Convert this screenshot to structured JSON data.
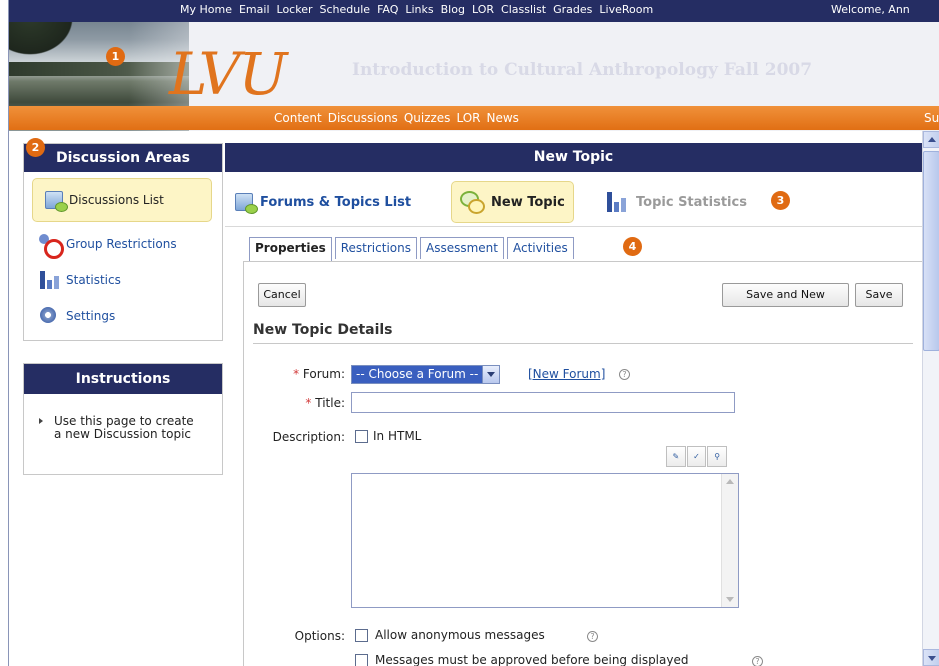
{
  "topnav": {
    "items": [
      "My Home",
      "Email",
      "Locker",
      "Schedule",
      "FAQ",
      "Links",
      "Blog",
      "LOR",
      "Classlist",
      "Grades",
      "LiveRoom"
    ],
    "welcome": "Welcome, Ann"
  },
  "banner": {
    "logo": "LVU",
    "course_title": "Introduction to Cultural Anthropology Fall 2007"
  },
  "subnav": {
    "items": [
      "Content",
      "Discussions",
      "Quizzes",
      "LOR",
      "News"
    ],
    "overflow": "Su"
  },
  "callouts": [
    "1",
    "2",
    "3",
    "4"
  ],
  "sidebar": {
    "title": "Discussion Areas",
    "items": [
      {
        "label": "Discussions List",
        "icon": "discussions-list-icon"
      },
      {
        "label": "Group Restrictions",
        "icon": "group-restrictions-icon"
      },
      {
        "label": "Statistics",
        "icon": "statistics-icon"
      },
      {
        "label": "Settings",
        "icon": "settings-icon"
      }
    ]
  },
  "instructions": {
    "title": "Instructions",
    "text": "Use this page to create a new Discussion topic"
  },
  "main": {
    "title": "New Topic",
    "actions": [
      {
        "label": "Forums & Topics List",
        "icon": "forums-list-icon"
      },
      {
        "label": "New Topic",
        "icon": "new-topic-icon"
      },
      {
        "label": "Topic Statistics",
        "icon": "topic-statistics-icon"
      }
    ],
    "tabs": [
      "Properties",
      "Restrictions",
      "Assessment",
      "Activities"
    ]
  },
  "form": {
    "cancel_label": "Cancel",
    "save_new_label": "Save and New",
    "save_label": "Save",
    "section_title": "New Topic Details",
    "forum_label": "Forum:",
    "forum_value": "-- Choose a Forum --",
    "new_forum_link": "[New Forum]",
    "title_label": "Title:",
    "title_value": "",
    "description_label": "Description:",
    "in_html_label": "In HTML",
    "description_value": "",
    "options_label": "Options:",
    "option_anonymous": "Allow anonymous messages",
    "option_approved": "Messages must be approved before being displayed",
    "required_mark": "*",
    "help_glyph": "?"
  },
  "colors": {
    "nav_bg": "#252d63",
    "accent_orange": "#e16f14",
    "link_blue": "#1f4f9f",
    "highlight_yellow": "#fdf5c6"
  }
}
